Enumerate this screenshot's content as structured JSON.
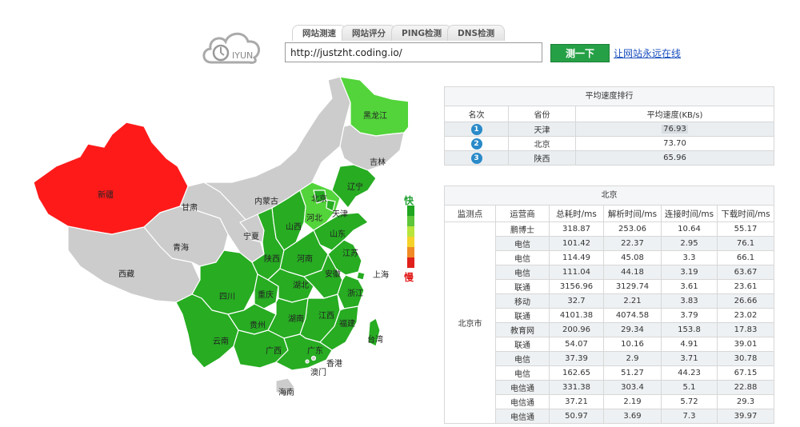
{
  "logo": {
    "text": "IYUN"
  },
  "tabs": [
    "网站测速",
    "网站评分",
    "PING检测",
    "DNS检测"
  ],
  "search": {
    "url": "http://justzht.coding.io/"
  },
  "test_button": "测一下",
  "link_text": "让网站永远在线",
  "legend": {
    "fast": "快",
    "slow": "慢",
    "colors": [
      "#1fa51f",
      "#5dc63a",
      "#b8e43c",
      "#f4d22a",
      "#f08a24",
      "#e0201a"
    ]
  },
  "map": {
    "colors": {
      "red": "#ff1a1a",
      "gray": "#cccccc",
      "green": "#27ac22",
      "light": "#52d43a"
    },
    "provinces": [
      "新疆",
      "西藏",
      "青海",
      "甘肃",
      "内蒙古",
      "宁夏",
      "黑龙江",
      "吉林",
      "辽宁",
      "北京",
      "天津",
      "河北",
      "山西",
      "山东",
      "陕西",
      "河南",
      "江苏",
      "四川",
      "重庆",
      "湖北",
      "安徽",
      "上海",
      "浙江",
      "贵州",
      "湖南",
      "江西",
      "福建",
      "云南",
      "广西",
      "广东",
      "台湾",
      "香港",
      "澳门",
      "海南"
    ]
  },
  "ranking": {
    "title": "平均速度排行",
    "headers": [
      "名次",
      "省份",
      "平均速度(KB/s)"
    ],
    "rows": [
      {
        "rank": "1",
        "province": "天津",
        "speed": "76.93"
      },
      {
        "rank": "2",
        "province": "北京",
        "speed": "73.70"
      },
      {
        "rank": "3",
        "province": "陕西",
        "speed": "65.96"
      }
    ]
  },
  "detail": {
    "title": "北京",
    "headers": [
      "监测点",
      "运营商",
      "总耗时/ms",
      "解析时间/ms",
      "连接时间/ms",
      "下载时间/ms"
    ],
    "city": "北京市",
    "rows": [
      [
        "鹏博士",
        "318.87",
        "253.06",
        "10.64",
        "55.17"
      ],
      [
        "电信",
        "101.42",
        "22.37",
        "2.95",
        "76.1"
      ],
      [
        "电信",
        "114.49",
        "45.08",
        "3.3",
        "66.1"
      ],
      [
        "电信",
        "111.04",
        "44.18",
        "3.19",
        "63.67"
      ],
      [
        "联通",
        "3156.96",
        "3129.74",
        "3.61",
        "23.61"
      ],
      [
        "移动",
        "32.7",
        "2.21",
        "3.83",
        "26.66"
      ],
      [
        "联通",
        "4101.38",
        "4074.58",
        "3.79",
        "23.02"
      ],
      [
        "教育网",
        "200.96",
        "29.34",
        "153.8",
        "17.83"
      ],
      [
        "联通",
        "54.07",
        "10.16",
        "4.91",
        "39.01"
      ],
      [
        "电信",
        "37.39",
        "2.9",
        "3.71",
        "30.78"
      ],
      [
        "电信",
        "162.65",
        "51.27",
        "44.23",
        "67.15"
      ],
      [
        "电信通",
        "331.38",
        "303.4",
        "5.1",
        "22.88"
      ],
      [
        "电信通",
        "37.21",
        "2.19",
        "5.72",
        "29.3"
      ],
      [
        "电信通",
        "50.97",
        "3.69",
        "7.3",
        "39.97"
      ]
    ]
  }
}
